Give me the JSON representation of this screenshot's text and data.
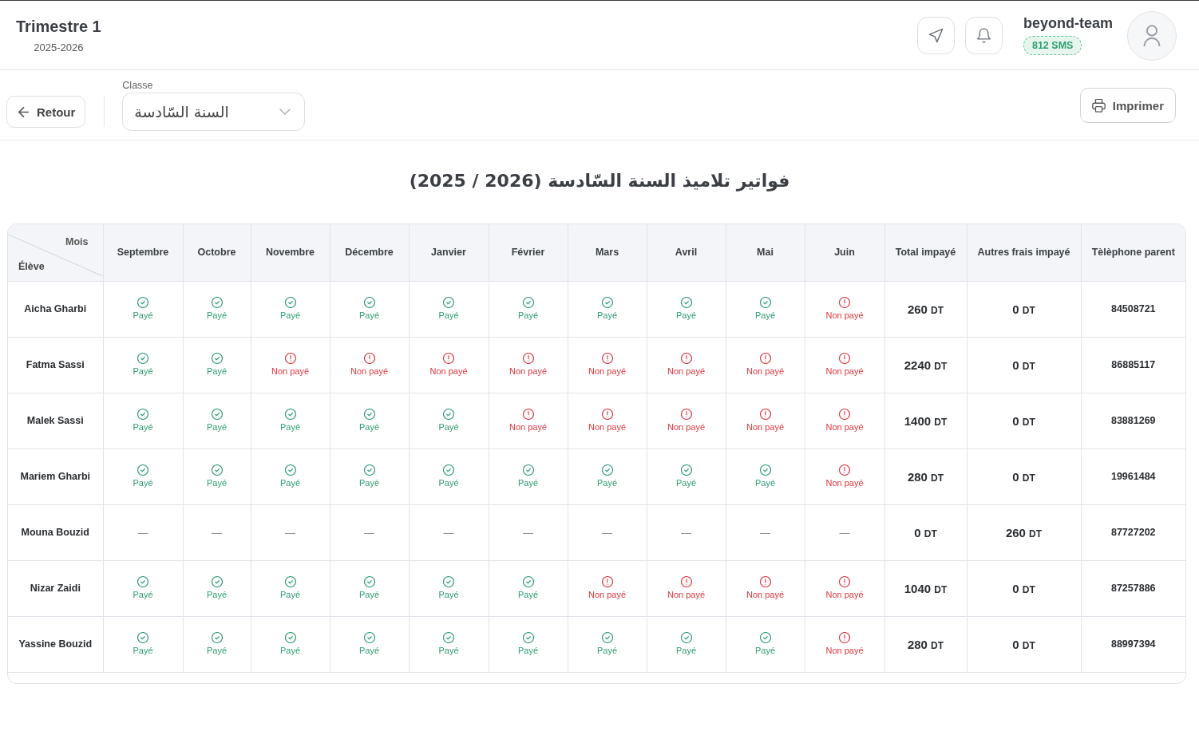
{
  "header": {
    "title": "Trimestre 1",
    "year": "2025-2026",
    "user": {
      "name": "beyond-team",
      "sms": "812 SMS"
    }
  },
  "toolbar": {
    "back_button": "Retour",
    "class_select": {
      "label": "Classe",
      "value": "السنة السّادسة"
    },
    "print_button": "Imprimer"
  },
  "heading": "فواتير تلاميذ السنة السّادسة (2026 / 2025)",
  "table": {
    "corner": {
      "columns_label": "Mois",
      "rows_label": "Élève"
    },
    "columns": [
      "Septembre",
      "Octobre",
      "Novembre",
      "Décembre",
      "Janvier",
      "Février",
      "Mars",
      "Avril",
      "Mai",
      "Juin",
      "Total impayé",
      "Autres frais impayé",
      "Tèlèphone parent"
    ],
    "rows": [
      {
        "student": "Aicha Gharbi",
        "months": [
          {
            "kind": "paid",
            "label": "Payé"
          },
          {
            "kind": "paid",
            "label": "Payé"
          },
          {
            "kind": "paid",
            "label": "Payé"
          },
          {
            "kind": "paid",
            "label": "Payé"
          },
          {
            "kind": "paid",
            "label": "Payé"
          },
          {
            "kind": "paid",
            "label": "Payé"
          },
          {
            "kind": "paid",
            "label": "Payé"
          },
          {
            "kind": "paid",
            "label": "Payé"
          },
          {
            "kind": "paid",
            "label": "Payé"
          },
          {
            "kind": "unpaid",
            "label": "Non payé"
          }
        ],
        "total_unpaid": {
          "amount": "260",
          "unit": "DT"
        },
        "other_fees_unpaid": {
          "amount": "0",
          "unit": "DT"
        },
        "parent_phone": "84508721"
      },
      {
        "student": "Fatma Sassi",
        "months": [
          {
            "kind": "paid",
            "label": "Payé"
          },
          {
            "kind": "paid",
            "label": "Payé"
          },
          {
            "kind": "unpaid",
            "label": "Non payé"
          },
          {
            "kind": "unpaid",
            "label": "Non payé"
          },
          {
            "kind": "unpaid",
            "label": "Non payé"
          },
          {
            "kind": "unpaid",
            "label": "Non payé"
          },
          {
            "kind": "unpaid",
            "label": "Non payé"
          },
          {
            "kind": "unpaid",
            "label": "Non payé"
          },
          {
            "kind": "unpaid",
            "label": "Non payé"
          },
          {
            "kind": "unpaid",
            "label": "Non payé"
          }
        ],
        "total_unpaid": {
          "amount": "2240",
          "unit": "DT"
        },
        "other_fees_unpaid": {
          "amount": "0",
          "unit": "DT"
        },
        "parent_phone": "86885117"
      },
      {
        "student": "Malek Sassi",
        "months": [
          {
            "kind": "paid",
            "label": "Payé"
          },
          {
            "kind": "paid",
            "label": "Payé"
          },
          {
            "kind": "paid",
            "label": "Payé"
          },
          {
            "kind": "paid",
            "label": "Payé"
          },
          {
            "kind": "paid",
            "label": "Payé"
          },
          {
            "kind": "unpaid",
            "label": "Non payé"
          },
          {
            "kind": "unpaid",
            "label": "Non payé"
          },
          {
            "kind": "unpaid",
            "label": "Non payé"
          },
          {
            "kind": "unpaid",
            "label": "Non payé"
          },
          {
            "kind": "unpaid",
            "label": "Non payé"
          }
        ],
        "total_unpaid": {
          "amount": "1400",
          "unit": "DT"
        },
        "other_fees_unpaid": {
          "amount": "0",
          "unit": "DT"
        },
        "parent_phone": "83881269"
      },
      {
        "student": "Mariem Gharbi",
        "months": [
          {
            "kind": "paid",
            "label": "Payé"
          },
          {
            "kind": "paid",
            "label": "Payé"
          },
          {
            "kind": "paid",
            "label": "Payé"
          },
          {
            "kind": "paid",
            "label": "Payé"
          },
          {
            "kind": "paid",
            "label": "Payé"
          },
          {
            "kind": "paid",
            "label": "Payé"
          },
          {
            "kind": "paid",
            "label": "Payé"
          },
          {
            "kind": "paid",
            "label": "Payé"
          },
          {
            "kind": "paid",
            "label": "Payé"
          },
          {
            "kind": "unpaid",
            "label": "Non payé"
          }
        ],
        "total_unpaid": {
          "amount": "280",
          "unit": "DT"
        },
        "other_fees_unpaid": {
          "amount": "0",
          "unit": "DT"
        },
        "parent_phone": "19961484"
      },
      {
        "student": "Mouna Bouzid",
        "months": [
          {
            "kind": "none",
            "label": "—"
          },
          {
            "kind": "none",
            "label": "—"
          },
          {
            "kind": "none",
            "label": "—"
          },
          {
            "kind": "none",
            "label": "—"
          },
          {
            "kind": "none",
            "label": "—"
          },
          {
            "kind": "none",
            "label": "—"
          },
          {
            "kind": "none",
            "label": "—"
          },
          {
            "kind": "none",
            "label": "—"
          },
          {
            "kind": "none",
            "label": "—"
          },
          {
            "kind": "none",
            "label": "—"
          }
        ],
        "total_unpaid": {
          "amount": "0",
          "unit": "DT"
        },
        "other_fees_unpaid": {
          "amount": "260",
          "unit": "DT"
        },
        "parent_phone": "87727202"
      },
      {
        "student": "Nizar Zaidi",
        "months": [
          {
            "kind": "paid",
            "label": "Payé"
          },
          {
            "kind": "paid",
            "label": "Payé"
          },
          {
            "kind": "paid",
            "label": "Payé"
          },
          {
            "kind": "paid",
            "label": "Payé"
          },
          {
            "kind": "paid",
            "label": "Payé"
          },
          {
            "kind": "paid",
            "label": "Payé"
          },
          {
            "kind": "unpaid",
            "label": "Non payé"
          },
          {
            "kind": "unpaid",
            "label": "Non payé"
          },
          {
            "kind": "unpaid",
            "label": "Non payé"
          },
          {
            "kind": "unpaid",
            "label": "Non payé"
          }
        ],
        "total_unpaid": {
          "amount": "1040",
          "unit": "DT"
        },
        "other_fees_unpaid": {
          "amount": "0",
          "unit": "DT"
        },
        "parent_phone": "87257886"
      },
      {
        "student": "Yassine Bouzid",
        "months": [
          {
            "kind": "paid",
            "label": "Payé"
          },
          {
            "kind": "paid",
            "label": "Payé"
          },
          {
            "kind": "paid",
            "label": "Payé"
          },
          {
            "kind": "paid",
            "label": "Payé"
          },
          {
            "kind": "paid",
            "label": "Payé"
          },
          {
            "kind": "paid",
            "label": "Payé"
          },
          {
            "kind": "paid",
            "label": "Payé"
          },
          {
            "kind": "paid",
            "label": "Payé"
          },
          {
            "kind": "paid",
            "label": "Payé"
          },
          {
            "kind": "unpaid",
            "label": "Non payé"
          }
        ],
        "total_unpaid": {
          "amount": "280",
          "unit": "DT"
        },
        "other_fees_unpaid": {
          "amount": "0",
          "unit": "DT"
        },
        "parent_phone": "88997394"
      }
    ]
  }
}
